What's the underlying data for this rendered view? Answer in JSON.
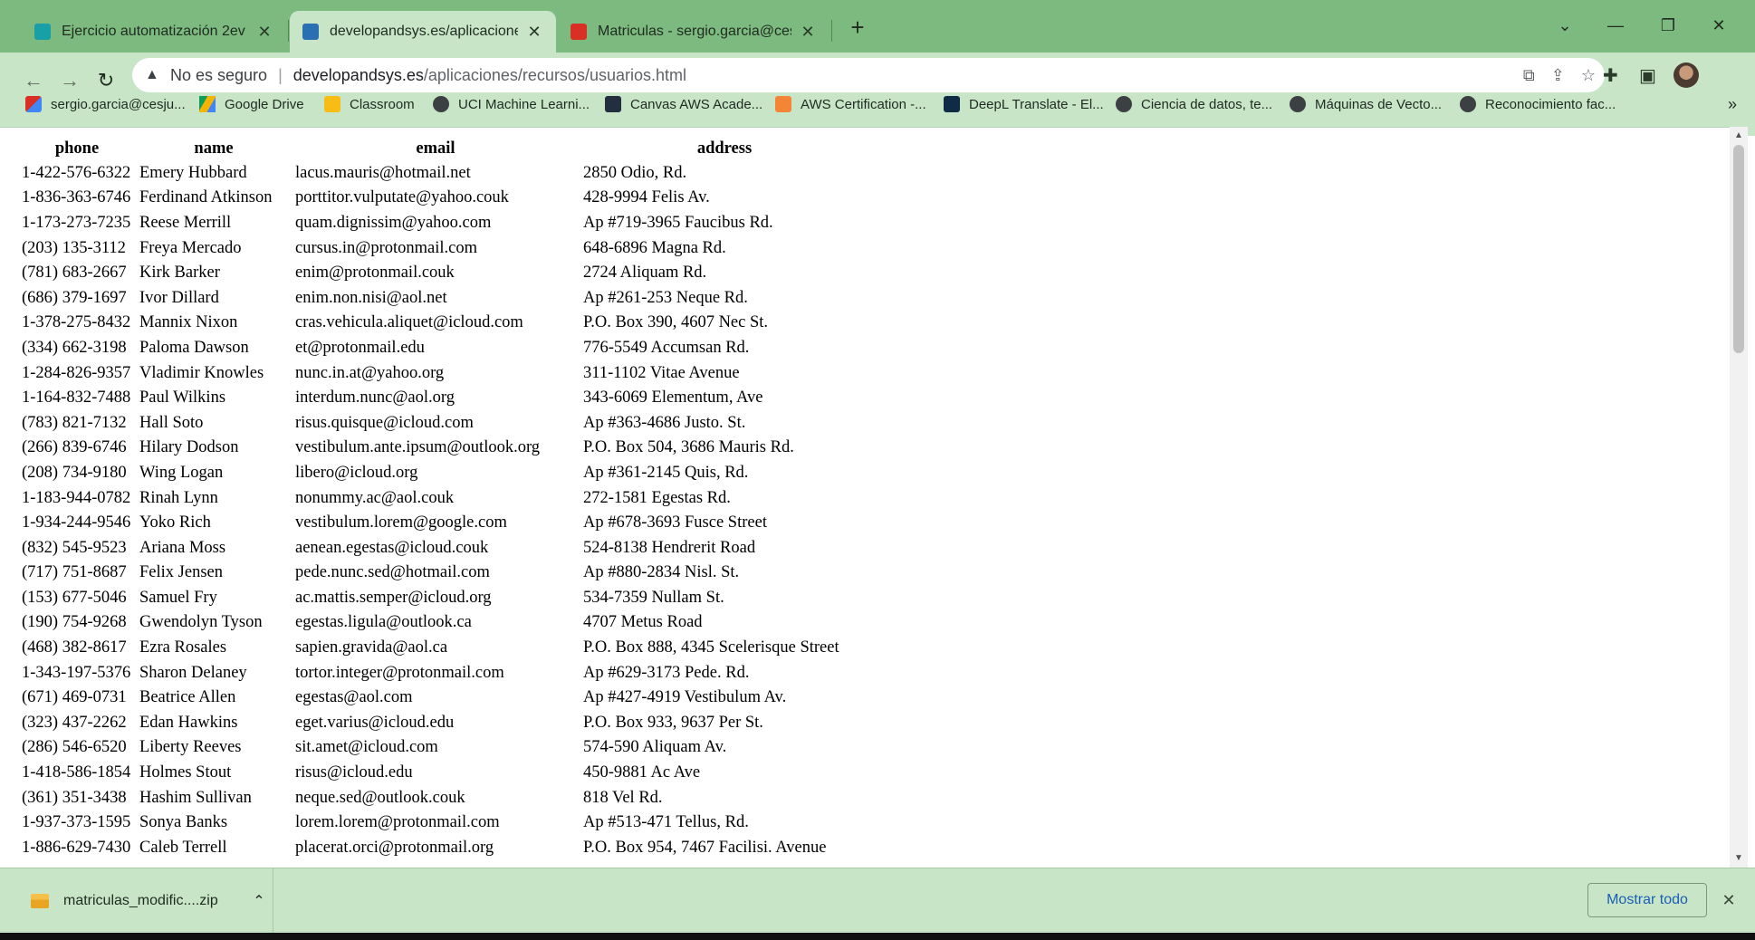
{
  "tabs": [
    {
      "title": "Ejercicio automatización 2ev",
      "favicon_color": "#18a0a6",
      "active": false
    },
    {
      "title": "developandsys.es/aplicaciones/re",
      "favicon_color": "#2b6fb3",
      "active": true
    },
    {
      "title": "Matriculas - sergio.garcia@cesju",
      "favicon_color": "#d93025",
      "active": false
    }
  ],
  "tab_close_glyph": "✕",
  "new_tab_glyph": "+",
  "window_controls": {
    "tab_search": "⌄",
    "minimize": "—",
    "restore": "❐",
    "close": "✕"
  },
  "nav": {
    "back": "←",
    "forward": "→",
    "reload": "↻"
  },
  "address_bar": {
    "security_icon": "▲",
    "security_text": "No es seguro",
    "separator": "|",
    "host": "developandsys.es",
    "path": "/aplicaciones/recursos/usuarios.html"
  },
  "address_actions": {
    "translate": "⧉",
    "share": "⇪",
    "bookmark_star": "☆"
  },
  "toolbar_actions": {
    "extensions": "✚",
    "side_panel": "▣"
  },
  "bookmarks": [
    {
      "label": "sergio.garcia@cesju...",
      "icon": "gmail-icon",
      "color": "#d93025"
    },
    {
      "label": "Google Drive",
      "icon": "drive-icon",
      "color": "#f4b400"
    },
    {
      "label": "Classroom",
      "icon": "classroom-icon",
      "color": "#f9bc15"
    },
    {
      "label": "UCI Machine Learni...",
      "icon": "globe-icon",
      "color": "#3c4043"
    },
    {
      "label": "Canvas AWS Acade...",
      "icon": "aws-icon",
      "color": "#232f3e"
    },
    {
      "label": "AWS Certification -...",
      "icon": "aws-cert-icon",
      "color": "#f58536"
    },
    {
      "label": "DeepL Translate - El...",
      "icon": "deepl-icon",
      "color": "#0f2b46"
    },
    {
      "label": "Ciencia de datos, te...",
      "icon": "globe-icon",
      "color": "#3c4043"
    },
    {
      "label": "Máquinas de Vecto...",
      "icon": "globe-icon",
      "color": "#3c4043"
    },
    {
      "label": "Reconocimiento fac...",
      "icon": "globe-icon",
      "color": "#3c4043"
    }
  ],
  "bookmarks_more": "»",
  "table": {
    "headers": {
      "phone": "phone",
      "name": "name",
      "email": "email",
      "address": "address"
    },
    "rows": [
      {
        "phone": "1-422-576-6322",
        "name": "Emery Hubbard",
        "email": "lacus.mauris@hotmail.net",
        "address": "2850 Odio, Rd."
      },
      {
        "phone": "1-836-363-6746",
        "name": "Ferdinand Atkinson",
        "email": "porttitor.vulputate@yahoo.couk",
        "address": "428-9994 Felis Av."
      },
      {
        "phone": "1-173-273-7235",
        "name": "Reese Merrill",
        "email": "quam.dignissim@yahoo.com",
        "address": "Ap #719-3965 Faucibus Rd."
      },
      {
        "phone": "(203) 135-3112",
        "name": "Freya Mercado",
        "email": "cursus.in@protonmail.com",
        "address": "648-6896 Magna Rd."
      },
      {
        "phone": "(781) 683-2667",
        "name": "Kirk Barker",
        "email": "enim@protonmail.couk",
        "address": "2724 Aliquam Rd."
      },
      {
        "phone": "(686) 379-1697",
        "name": "Ivor Dillard",
        "email": "enim.non.nisi@aol.net",
        "address": "Ap #261-253 Neque Rd."
      },
      {
        "phone": "1-378-275-8432",
        "name": "Mannix Nixon",
        "email": "cras.vehicula.aliquet@icloud.com",
        "address": "P.O. Box 390, 4607 Nec St."
      },
      {
        "phone": "(334) 662-3198",
        "name": "Paloma Dawson",
        "email": "et@protonmail.edu",
        "address": "776-5549 Accumsan Rd."
      },
      {
        "phone": "1-284-826-9357",
        "name": "Vladimir Knowles",
        "email": "nunc.in.at@yahoo.org",
        "address": "311-1102 Vitae Avenue"
      },
      {
        "phone": "1-164-832-7488",
        "name": "Paul Wilkins",
        "email": "interdum.nunc@aol.org",
        "address": "343-6069 Elementum, Ave"
      },
      {
        "phone": "(783) 821-7132",
        "name": "Hall Soto",
        "email": "risus.quisque@icloud.com",
        "address": "Ap #363-4686 Justo. St."
      },
      {
        "phone": "(266) 839-6746",
        "name": "Hilary Dodson",
        "email": "vestibulum.ante.ipsum@outlook.org",
        "address": "P.O. Box 504, 3686 Mauris Rd."
      },
      {
        "phone": "(208) 734-9180",
        "name": "Wing Logan",
        "email": "libero@icloud.org",
        "address": "Ap #361-2145 Quis, Rd."
      },
      {
        "phone": "1-183-944-0782",
        "name": "Rinah Lynn",
        "email": "nonummy.ac@aol.couk",
        "address": "272-1581 Egestas Rd."
      },
      {
        "phone": "1-934-244-9546",
        "name": "Yoko Rich",
        "email": "vestibulum.lorem@google.com",
        "address": "Ap #678-3693 Fusce Street"
      },
      {
        "phone": "(832) 545-9523",
        "name": "Ariana Moss",
        "email": "aenean.egestas@icloud.couk",
        "address": "524-8138 Hendrerit Road"
      },
      {
        "phone": "(717) 751-8687",
        "name": "Felix Jensen",
        "email": "pede.nunc.sed@hotmail.com",
        "address": "Ap #880-2834 Nisl. St."
      },
      {
        "phone": "(153) 677-5046",
        "name": "Samuel Fry",
        "email": "ac.mattis.semper@icloud.org",
        "address": "534-7359 Nullam St."
      },
      {
        "phone": "(190) 754-9268",
        "name": "Gwendolyn Tyson",
        "email": "egestas.ligula@outlook.ca",
        "address": "4707 Metus Road"
      },
      {
        "phone": "(468) 382-8617",
        "name": "Ezra Rosales",
        "email": "sapien.gravida@aol.ca",
        "address": "P.O. Box 888, 4345 Scelerisque Street"
      },
      {
        "phone": "1-343-197-5376",
        "name": "Sharon Delaney",
        "email": "tortor.integer@protonmail.com",
        "address": "Ap #629-3173 Pede. Rd."
      },
      {
        "phone": "(671) 469-0731",
        "name": "Beatrice Allen",
        "email": "egestas@aol.com",
        "address": "Ap #427-4919 Vestibulum Av."
      },
      {
        "phone": "(323) 437-2262",
        "name": "Edan Hawkins",
        "email": "eget.varius@icloud.edu",
        "address": "P.O. Box 933, 9637 Per St."
      },
      {
        "phone": "(286) 546-6520",
        "name": "Liberty Reeves",
        "email": "sit.amet@icloud.com",
        "address": "574-590 Aliquam Av."
      },
      {
        "phone": "1-418-586-1854",
        "name": "Holmes Stout",
        "email": "risus@icloud.edu",
        "address": "450-9881 Ac Ave"
      },
      {
        "phone": "(361) 351-3438",
        "name": "Hashim Sullivan",
        "email": "neque.sed@outlook.couk",
        "address": "818 Vel Rd."
      },
      {
        "phone": "1-937-373-1595",
        "name": "Sonya Banks",
        "email": "lorem.lorem@protonmail.com",
        "address": "Ap #513-471 Tellus, Rd."
      },
      {
        "phone": "1-886-629-7430",
        "name": "Caleb Terrell",
        "email": "placerat.orci@protonmail.org",
        "address": "P.O. Box 954, 7467 Facilisi. Avenue"
      }
    ]
  },
  "scrollbar": {
    "up": "▲",
    "down": "▼"
  },
  "download_bar": {
    "file_name": "matriculas_modific....zip",
    "chevron": "⌃",
    "show_all": "Mostrar todo",
    "close": "✕"
  }
}
